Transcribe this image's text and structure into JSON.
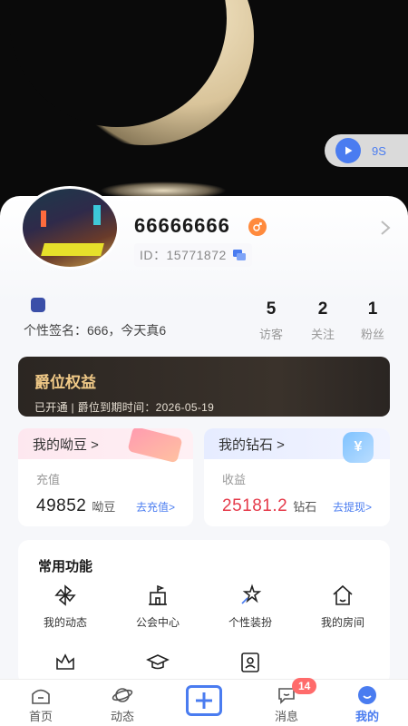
{
  "player": {
    "time": "9S",
    "icon": "play-icon"
  },
  "profile": {
    "nickname": "66666666",
    "id_label": "ID：15771872",
    "signature": "个性签名：666，今天真6"
  },
  "stats": [
    {
      "value": "5",
      "label": "访客"
    },
    {
      "value": "2",
      "label": "关注"
    },
    {
      "value": "1",
      "label": "粉丝"
    }
  ],
  "vip": {
    "title": "爵位权益",
    "subtitle": "已开通 | 爵位到期时间：2026-05-19"
  },
  "wallet_beans": {
    "title": "我的呦豆 >",
    "label": "充值",
    "amount": "49852",
    "unit": "呦豆",
    "link": "去充值>"
  },
  "wallet_diamonds": {
    "title": "我的钻石 >",
    "label": "收益",
    "amount": "25181.2",
    "unit": "钻石",
    "link": "去提现>",
    "deco_symbol": "¥"
  },
  "functions": {
    "title": "常用功能",
    "items": [
      {
        "label": "我的动态",
        "icon": "pinwheel-icon"
      },
      {
        "label": "公会中心",
        "icon": "building-icon"
      },
      {
        "label": "个性装扮",
        "icon": "star-wand-icon"
      },
      {
        "label": "我的房间",
        "icon": "house-icon"
      },
      {
        "label": "",
        "icon": "crown-icon"
      },
      {
        "label": "",
        "icon": "graduation-cap-icon"
      },
      {
        "label": "",
        "icon": "contact-card-icon"
      }
    ]
  },
  "tabbar": {
    "items": [
      {
        "label": "首页",
        "icon": "home-icon"
      },
      {
        "label": "动态",
        "icon": "planet-icon"
      },
      {
        "label": "",
        "icon": "add-icon"
      },
      {
        "label": "消息",
        "icon": "chat-icon",
        "badge": "14"
      },
      {
        "label": "我的",
        "icon": "profile-icon",
        "active": true
      }
    ]
  },
  "colors": {
    "accent": "#4a7cf0",
    "amount_red": "#e53a4a",
    "vip_gold": "#f0c987"
  }
}
